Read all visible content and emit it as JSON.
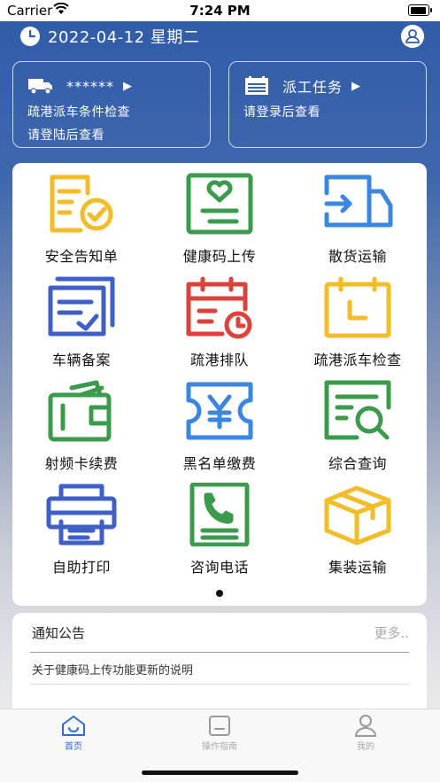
{
  "status_bar": {
    "carrier": "Carrier",
    "time": "7:24 PM"
  },
  "header": {
    "date": "2022-04-12 星期二"
  },
  "cards": {
    "vehicle": {
      "title": "******",
      "arrow": "▶",
      "line1": "疏港派车条件检查",
      "line2": "请登陆后查看"
    },
    "task": {
      "title": "派工任务",
      "arrow": "▶",
      "line1": "请登录后查看"
    }
  },
  "grid": {
    "items": [
      {
        "label": "安全告知单",
        "icon": "safety-notice-icon",
        "color": "#f2bd29"
      },
      {
        "label": "健康码上传",
        "icon": "health-code-icon",
        "color": "#3c9a4c"
      },
      {
        "label": "散货运输",
        "icon": "truck-transport-icon",
        "color": "#3a86e0"
      },
      {
        "label": "车辆备案",
        "icon": "vehicle-record-icon",
        "color": "#3f5fc7"
      },
      {
        "label": "疏港排队",
        "icon": "queue-calendar-icon",
        "color": "#d9433c"
      },
      {
        "label": "疏港派车检查",
        "icon": "dispatch-check-icon",
        "color": "#f2bd29"
      },
      {
        "label": "射频卡续费",
        "icon": "wallet-icon",
        "color": "#3c9a4c"
      },
      {
        "label": "黑名单缴费",
        "icon": "yen-ticket-icon",
        "color": "#3a86e0"
      },
      {
        "label": "综合查询",
        "icon": "query-search-icon",
        "color": "#3c9a4c"
      },
      {
        "label": "自助打印",
        "icon": "printer-icon",
        "color": "#3f5fc7"
      },
      {
        "label": "咨询电话",
        "icon": "phone-icon",
        "color": "#3c9a4c"
      },
      {
        "label": "集装运输",
        "icon": "box-icon",
        "color": "#f2bd29"
      }
    ]
  },
  "notice": {
    "title": "通知公告",
    "more": "更多..",
    "items": [
      "关于健康码上传功能更新的说明"
    ]
  },
  "tabbar": {
    "home": "首页",
    "guide": "操作指南",
    "mine": "我的",
    "active_color": "#2e6bd8"
  }
}
